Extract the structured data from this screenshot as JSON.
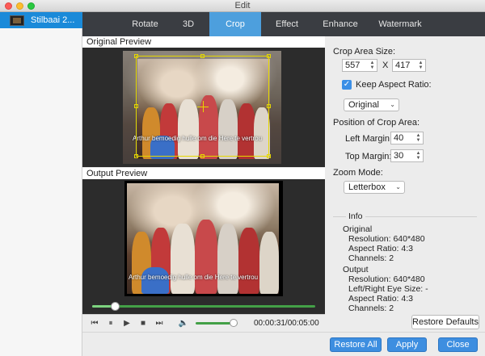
{
  "window": {
    "title": "Edit"
  },
  "sidebar": {
    "file_name": "Stilbaai 2..."
  },
  "tabs": [
    {
      "label": "Rotate",
      "active": false
    },
    {
      "label": "3D",
      "active": false
    },
    {
      "label": "Crop",
      "active": true
    },
    {
      "label": "Effect",
      "active": false
    },
    {
      "label": "Enhance",
      "active": false
    },
    {
      "label": "Watermark",
      "active": false
    }
  ],
  "preview": {
    "original_label": "Original Preview",
    "output_label": "Output Preview",
    "subtitle": "Arthur bemoedig hulle om die Here te vertrou",
    "progress_fraction": 0.1,
    "volume_fraction": 0.9,
    "timecode": "00:00:31/00:05:00"
  },
  "crop": {
    "area_size_label": "Crop Area Size:",
    "width": "557",
    "x_sep": "X",
    "height": "417",
    "keep_aspect_label": "Keep Aspect Ratio:",
    "keep_aspect_checked": true,
    "aspect_option": "Original",
    "position_label": "Position of Crop Area:",
    "left_margin_label": "Left Margin:",
    "left_margin": "40",
    "top_margin_label": "Top Margin:",
    "top_margin": "30",
    "zoom_label": "Zoom Mode:",
    "zoom_option": "Letterbox"
  },
  "info": {
    "title": "Info",
    "original_title": "Original",
    "original_resolution": "Resolution: 640*480",
    "original_aspect": "Aspect Ratio: 4:3",
    "original_channels": "Channels: 2",
    "output_title": "Output",
    "output_resolution": "Resolution: 640*480",
    "output_eye_size": "Left/Right Eye Size: -",
    "output_aspect": "Aspect Ratio: 4:3",
    "output_channels": "Channels: 2"
  },
  "buttons": {
    "restore_defaults": "Restore Defaults",
    "restore_all": "Restore All",
    "apply": "Apply",
    "close": "Close"
  },
  "colors": {
    "accent": "#4d9fdd",
    "progress": "#43a047",
    "crop_frame": "#e6d800"
  }
}
